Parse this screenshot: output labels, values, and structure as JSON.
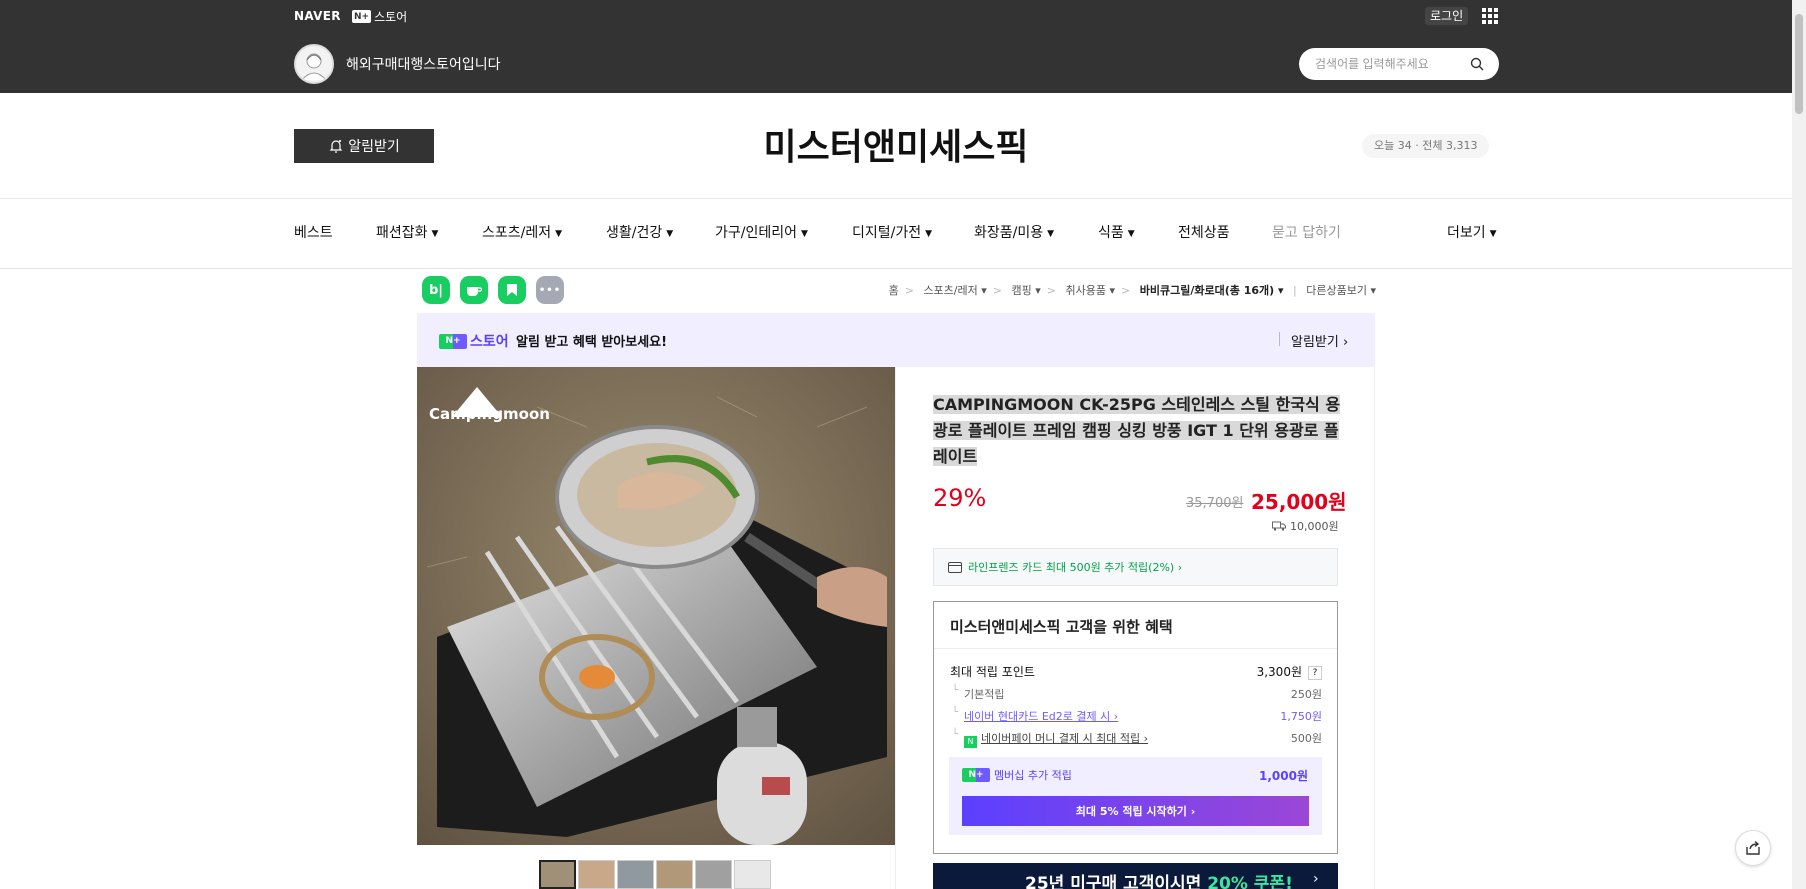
{
  "topbar": {
    "naver_logo": "NAVER",
    "nstore_badge": "N+",
    "nstore_word": "스토어",
    "login_label": "로그인",
    "store_slogan": "해외구매대행스토어입니다"
  },
  "search": {
    "placeholder": "검색어를 입력해주세요"
  },
  "store": {
    "notify_label": "알림받기",
    "title": "미스터앤미세스픽",
    "visit_today": "오늘 34",
    "visit_total": "전체 3,313"
  },
  "categories": [
    {
      "label": "베스트",
      "chevron": false
    },
    {
      "label": "패션잡화",
      "chevron": true
    },
    {
      "label": "스포츠/레저",
      "chevron": true
    },
    {
      "label": "생활/건강",
      "chevron": true
    },
    {
      "label": "가구/인테리어",
      "chevron": true
    },
    {
      "label": "디지털/가전",
      "chevron": true
    },
    {
      "label": "화장품/미용",
      "chevron": true
    },
    {
      "label": "식품",
      "chevron": true
    },
    {
      "label": "전체상품",
      "chevron": false
    },
    {
      "label": "묻고 답하기",
      "chevron": false
    },
    {
      "label": "더보기",
      "chevron": true
    }
  ],
  "share_icons": [
    {
      "name": "blog-share-icon",
      "glyph": "b|",
      "color": "#19ce60"
    },
    {
      "name": "cafe-share-icon",
      "glyph": "☕",
      "color": "#19ce60"
    },
    {
      "name": "bookmark-share-icon",
      "glyph": "🔖",
      "color": "#19ce60"
    },
    {
      "name": "more-share-icon",
      "glyph": "•••",
      "color": "#a5a9b4"
    }
  ],
  "breadcrumb": {
    "home": "홈",
    "level1": "스포츠/레저",
    "level2": "캠핑",
    "level3": "취사용품",
    "level4": "바비큐그릴/화로대(총 16개)",
    "other": "다른상품보기"
  },
  "promo": {
    "badge": "N+",
    "word": "스토어",
    "text": "알림 받고 혜택 받아보세요!",
    "cta": "알림받기 ›"
  },
  "product": {
    "brand_text": "Campingmoon",
    "title": "CAMPINGMOON CK-25PG 스테인레스 스틸 한국식 용광로 플레이트 프레임 캠핑 싱킹 방풍 IGT 1 단위 용광로 플레이트",
    "discount": "29%",
    "original_price": "35,700원",
    "sale_price": "25,000원",
    "shipping_fee": "10,000원",
    "card_offer": "라인프렌즈 카드 최대 500원 추가 적립(2%) ›"
  },
  "benefits": {
    "title": "미스터앤미세스픽 고객을 위한 혜택",
    "max_points_label": "최대 적립 포인트",
    "max_points_value": "3,300원",
    "help": "?",
    "rows": [
      {
        "label": "기본적립",
        "value": "250원"
      },
      {
        "label": "네이버 현대카드 Ed2로 결제 시 ›",
        "value": "1,750원"
      },
      {
        "label": "네이버페이 머니 결제 시 최대 적립 ›",
        "value": "500원"
      }
    ],
    "membership_badge": "N+",
    "membership_label": "멤버십 추가 적립",
    "membership_value": "1,000원",
    "membership_cta": "최대 5% 적립 시작하기 ›"
  },
  "coupon_banner": {
    "text_prefix": "25년 미구매 고객이시면 ",
    "text_highlight": "20% 쿠폰!",
    "chevron": "›"
  },
  "colors": {
    "accent_red": "#e2001b",
    "naver_green": "#19ce60",
    "nplus_purple": "#5b40ff",
    "header_dark": "#333333"
  }
}
